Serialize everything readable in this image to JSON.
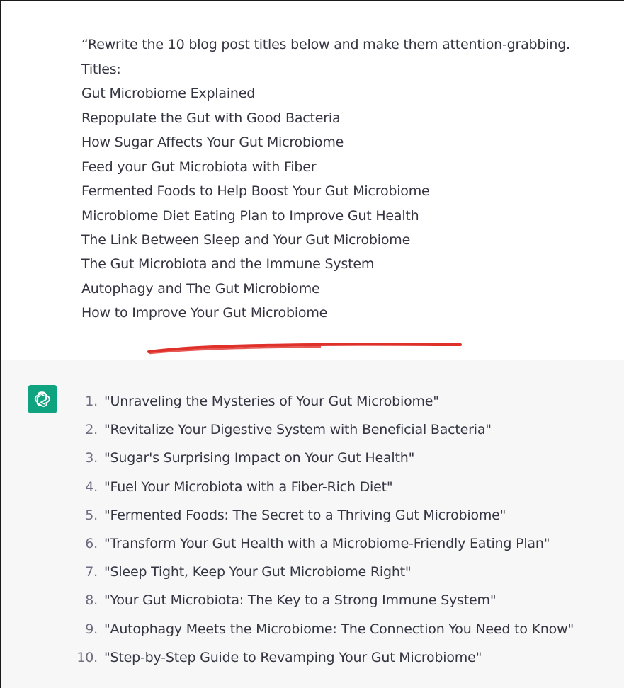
{
  "user_message": {
    "intro": "“Rewrite the 10 blog post titles below and make them attention-grabbing.",
    "titles_label": "Titles:",
    "titles": [
      "Gut Microbiome Explained",
      "Repopulate the Gut with Good Bacteria",
      "How Sugar Affects Your Gut Microbiome",
      "Feed your Gut Microbiota with Fiber",
      "Fermented Foods to Help Boost Your Gut Microbiome",
      "Microbiome Diet Eating Plan to Improve Gut Health",
      "The Link Between Sleep and Your Gut Microbiome",
      "The Gut Microbiota and the Immune System",
      "Autophagy and The Gut Microbiome",
      "How to Improve Your Gut Microbiome"
    ]
  },
  "assistant_message": {
    "avatar_icon": "chatgpt-logo-icon",
    "avatar_color": "#10a37f",
    "items": [
      {
        "num": "1.",
        "text": "\"Unraveling the Mysteries of Your Gut Microbiome\""
      },
      {
        "num": "2.",
        "text": "\"Revitalize Your Digestive System with Beneficial Bacteria\""
      },
      {
        "num": "3.",
        "text": "\"Sugar's Surprising Impact on Your Gut Health\""
      },
      {
        "num": "4.",
        "text": "\"Fuel Your Microbiota with a Fiber-Rich Diet\""
      },
      {
        "num": "5.",
        "text": "\"Fermented Foods: The Secret to a Thriving Gut Microbiome\""
      },
      {
        "num": "6.",
        "text": "\"Transform Your Gut Health with a Microbiome-Friendly Eating Plan\""
      },
      {
        "num": "7.",
        "text": "\"Sleep Tight, Keep Your Gut Microbiome Right\""
      },
      {
        "num": "8.",
        "text": "\"Your Gut Microbiota: The Key to a Strong Immune System\""
      },
      {
        "num": "9.",
        "text": "\"Autophagy Meets the Microbiome: The Connection You Need to Know\""
      },
      {
        "num": "10.",
        "text": "\"Step-by-Step Guide to Revamping Your Gut Microbiome\""
      }
    ]
  },
  "colors": {
    "text": "#343541",
    "number": "#6e6e80",
    "assistant_bg": "#f7f7f8",
    "annotation_stroke": "#e0302a"
  }
}
